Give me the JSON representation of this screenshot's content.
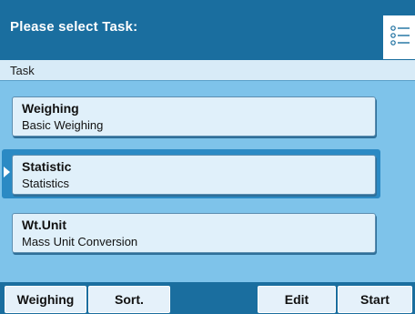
{
  "header": {
    "title": "Please select Task:",
    "menu_icon": "list-menu-icon"
  },
  "subheader": {
    "label": "Task"
  },
  "tasks": [
    {
      "title": "Weighing",
      "subtitle": "Basic Weighing",
      "selected": false
    },
    {
      "title": "Statistic",
      "subtitle": "Statistics",
      "selected": true
    },
    {
      "title": "Wt.Unit",
      "subtitle": "Mass Unit Conversion",
      "selected": false
    }
  ],
  "softkeys": {
    "weighing": "Weighing",
    "sort": "Sort.",
    "edit": "Edit",
    "start": "Start"
  },
  "colors": {
    "header": "#1a6e9f",
    "background": "#7ec3ea",
    "item": "#e0f0fa",
    "selected_frame": "#2b8ac4"
  }
}
